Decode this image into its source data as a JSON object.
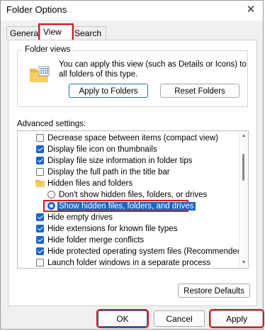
{
  "window": {
    "title": "Folder Options",
    "close_glyph": "✕"
  },
  "tabs": [
    {
      "label": "General",
      "active": false
    },
    {
      "label": "View",
      "active": true
    },
    {
      "label": "Search",
      "active": false
    }
  ],
  "folder_views": {
    "label": "Folder views",
    "description": "You can apply this view (such as Details or Icons) to all folders of this type.",
    "apply_button": "Apply to Folders",
    "reset_button": "Reset Folders",
    "icon": "folder-icon"
  },
  "advanced": {
    "label": "Advanced settings:",
    "items": [
      {
        "type": "checkbox",
        "checked": false,
        "label": "Decrease space between items (compact view)"
      },
      {
        "type": "checkbox",
        "checked": true,
        "label": "Display file icon on thumbnails"
      },
      {
        "type": "checkbox",
        "checked": true,
        "label": "Display file size information in folder tips"
      },
      {
        "type": "checkbox",
        "checked": false,
        "label": "Display the full path in the title bar"
      },
      {
        "type": "folder",
        "label": "Hidden files and folders"
      },
      {
        "type": "radio",
        "checked": false,
        "label": "Don't show hidden files, folders, or drives"
      },
      {
        "type": "radio",
        "checked": true,
        "selected": true,
        "label": "Show hidden files, folders, and drives"
      },
      {
        "type": "checkbox",
        "checked": true,
        "label": "Hide empty drives"
      },
      {
        "type": "checkbox",
        "checked": true,
        "label": "Hide extensions for known file types"
      },
      {
        "type": "checkbox",
        "checked": true,
        "label": "Hide folder merge conflicts"
      },
      {
        "type": "checkbox",
        "checked": true,
        "label": "Hide protected operating system files (Recommended)"
      },
      {
        "type": "checkbox",
        "checked": false,
        "label": "Launch folder windows in a separate process"
      }
    ]
  },
  "restore_button": "Restore Defaults",
  "footer": {
    "ok": "OK",
    "cancel": "Cancel",
    "apply": "Apply"
  },
  "colors": {
    "accent": "#1a64c9",
    "highlight_box": "#d9161d"
  }
}
